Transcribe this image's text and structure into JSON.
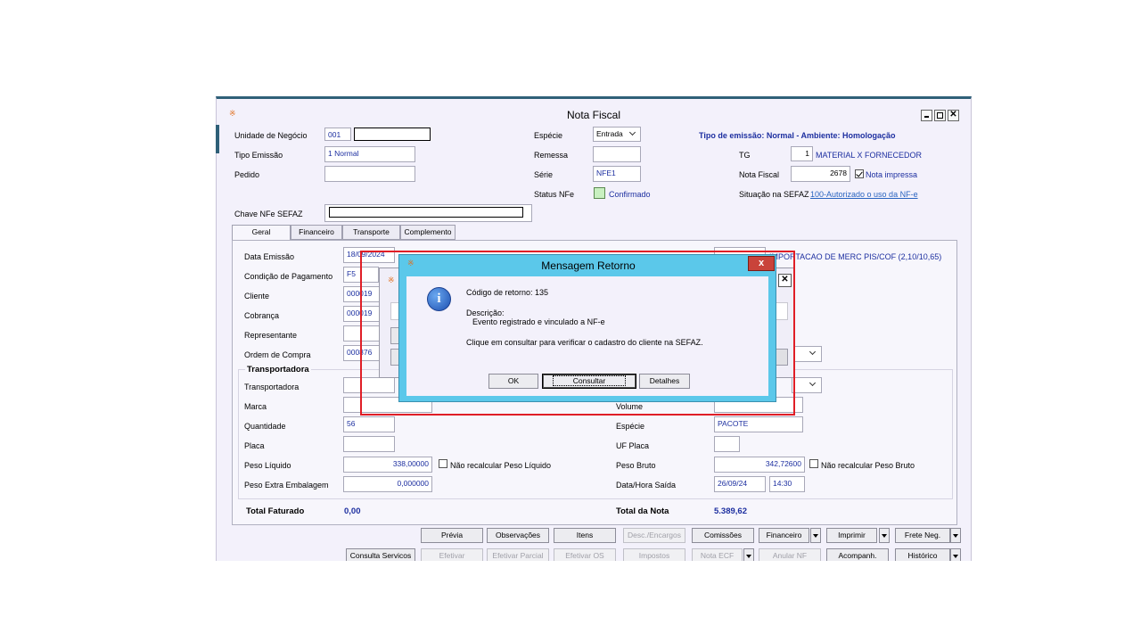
{
  "window": {
    "title": "Nota Fiscal",
    "emission_info": "Tipo de emissão: Normal - Ambiente: Homologação"
  },
  "header": {
    "unidade_label": "Unidade de Negócio",
    "unidade_value": "001",
    "tipo_emissao_label": "Tipo Emissão",
    "tipo_emissao_value": "1 Normal",
    "pedido_label": "Pedido",
    "chave_label": "Chave NFe SEFAZ",
    "especie_label": "Espécie",
    "especie_value": "Entrada",
    "remessa_label": "Remessa",
    "serie_label": "Série",
    "serie_value": "NFE1",
    "status_label": "Status NFe",
    "status_value": "Confirmado",
    "tg_label": "TG",
    "tg_value": "1",
    "tg_desc": "MATERIAL X FORNECEDOR",
    "nota_label": "Nota Fiscal",
    "nota_value": "2678",
    "nota_impressa": "Nota impressa",
    "situacao_label": "Situação na SEFAZ",
    "situacao_value": "100-Autorizado o uso da NF-e"
  },
  "tabs": [
    "Geral",
    "Financeiro",
    "Transporte",
    "Complemento"
  ],
  "form": {
    "data_emissao_label": "Data Emissão",
    "data_emissao_value": "18/09/2024",
    "tipo_operacao_text": "IMPORTACAO DE MERC PIS/COF (2,10/10,65)",
    "condicao_label": "Condição de Pagamento",
    "condicao_value": "F5",
    "cliente_label": "Cliente",
    "cliente_value": "000019",
    "cobranca_label": "Cobrança",
    "cobranca_value": "000019",
    "representante_label": "Representante",
    "ordem_label": "Ordem de Compra",
    "ordem_value": "000876",
    "transportadora_group": "Transportadora",
    "transportadora_label": "Transportadora",
    "marca_label": "Marca",
    "volume_label": "Volume",
    "quantidade_label": "Quantidade",
    "quantidade_value": "56",
    "especie_label": "Espécie",
    "especie_value": "PACOTE",
    "placa_label": "Placa",
    "uf_placa_label": "UF Placa",
    "peso_liquido_label": "Peso Líquido",
    "peso_liquido_value": "338,00000",
    "nao_recalc_liq": "Não recalcular Peso Líquido",
    "peso_bruto_label": "Peso Bruto",
    "peso_bruto_value": "342,72600",
    "nao_recalc_bruto": "Não recalcular Peso Bruto",
    "peso_extra_label": "Peso Extra Embalagem",
    "peso_extra_value": "0,000000",
    "data_saida_label": "Data/Hora Saída",
    "data_saida_value": "26/09/24",
    "hora_saida_value": "14:30",
    "total_faturado_label": "Total Faturado",
    "total_faturado_value": "0,00",
    "total_nota_label": "Total da Nota",
    "total_nota_value": "5.389,62"
  },
  "buttons_row1": [
    "Prévia",
    "Observações",
    "Itens",
    "Desc./Encargos",
    "Comissões",
    "Financeiro",
    "Imprimir",
    "Frete Neg."
  ],
  "buttons_row2": [
    "Consulta Servicos",
    "Efetivar",
    "Efetivar Parcial",
    "Efetivar OS",
    "Impostos",
    "Nota ECF",
    "Anular NF",
    "Acompanh.",
    "Histórico"
  ],
  "dialog": {
    "title": "Mensagem Retorno",
    "codigo": "Código de retorno: 135",
    "descricao_label": "Descrição:",
    "descricao_value": "Evento registrado e vinculado a NF-e",
    "instrucao": "Clique em consultar para verificar o cadastro do cliente na SEFAZ.",
    "ok": "OK",
    "consultar": "Consultar",
    "detalhes": "Detalhes",
    "close": "x"
  },
  "colors": {
    "accent": "#2f6078",
    "dialog_frame": "#5bc8ea",
    "highlight": "#e01e26",
    "close_button": "#c9433a"
  }
}
